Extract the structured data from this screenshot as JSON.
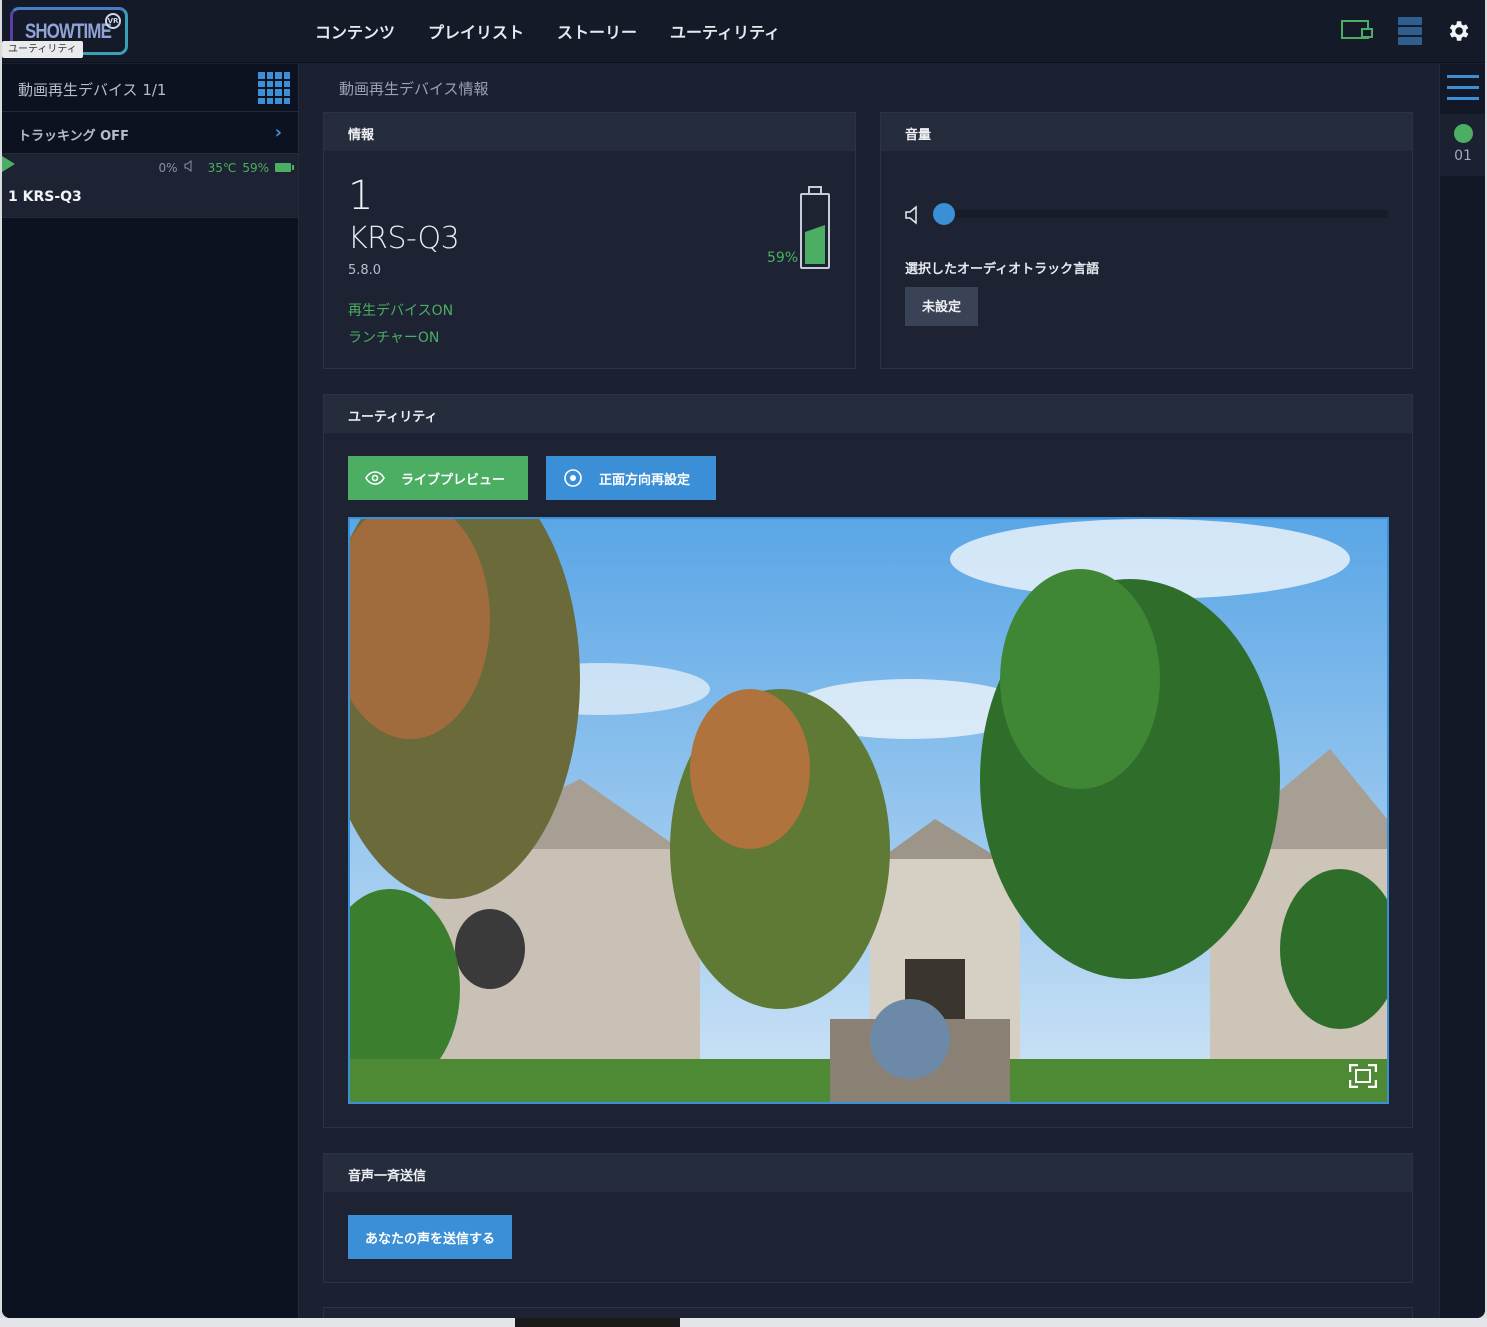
{
  "app": {
    "logo_text": "SHOWTIME",
    "logo_badge": "VR",
    "tooltip": "ユーティリティ"
  },
  "nav": [
    {
      "label": "コンテンツ"
    },
    {
      "label": "プレイリスト"
    },
    {
      "label": "ストーリー"
    },
    {
      "label": "ユーティリティ"
    }
  ],
  "top_icons": [
    "device-screen-icon",
    "server-icon",
    "gear-icon"
  ],
  "sidebar": {
    "title": "動画再生デバイス 1/1",
    "tracking_label": "トラッキング  OFF",
    "device": {
      "volume": "0%",
      "temperature": "35℃",
      "battery": "59%",
      "name": "1  KRS-Q3"
    }
  },
  "rail": {
    "device_number": "01",
    "status_color": "#4cae63"
  },
  "main": {
    "page_title": "動画再生デバイス情報",
    "info": {
      "heading": "情報",
      "number": "1",
      "model": "KRS-Q3",
      "version": "5.8.0",
      "status_player": "再生デバイスON",
      "status_launcher": "ランチャーON",
      "battery_percent": "59%",
      "battery_level": 0.59
    },
    "volume": {
      "heading": "音量",
      "level": 0,
      "audio_track_label": "選択したオーディオトラック言語",
      "audio_track_value": "未設定"
    },
    "utility": {
      "heading": "ユーティリティ",
      "live_preview_label": "ライブプレビュー",
      "recenter_label": "正面方向再設定"
    },
    "voice": {
      "heading": "音声一斉送信",
      "send_label": "あなたの声を送信する"
    }
  },
  "colors": {
    "accent_blue": "#3a8fd6",
    "accent_green": "#4cae63",
    "bg": "#1b2130"
  }
}
